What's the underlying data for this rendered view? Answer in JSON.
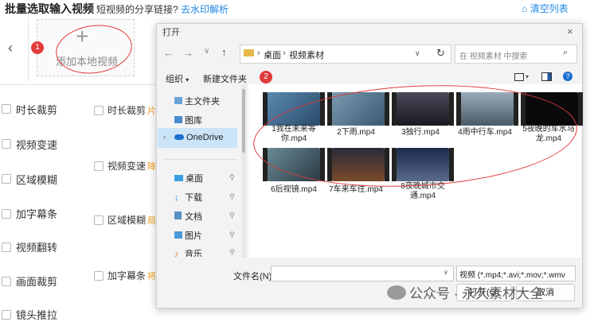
{
  "app": {
    "title": "批量选取输入视频",
    "share_prompt": "短视频的分享链接?",
    "remove_watermark_link": "去水印解析",
    "clear_list": "清空列表",
    "add_local_video": "添加本地视频",
    "left_options": [
      "时长裁剪",
      "视频变速",
      "区域模糊",
      "加字幕条",
      "视频翻转",
      "画面裁剪",
      "镜头推拉"
    ],
    "mid_options": [
      {
        "label": "时长裁剪",
        "hint": "片"
      },
      {
        "label": "视频变速",
        "hint": "降"
      },
      {
        "label": "区域模糊",
        "hint": "局"
      },
      {
        "label": "加字幕条",
        "hint": "将"
      }
    ]
  },
  "annotations": {
    "badge1": "1",
    "badge2": "2",
    "accent": "#e23b3b"
  },
  "dialog": {
    "title": "打开",
    "close": "×",
    "nav": {
      "back": "←",
      "forward": "→",
      "dropdown": "∨",
      "up": "↑"
    },
    "breadcrumb": [
      "桌面",
      "视频素材"
    ],
    "refresh": "↻",
    "search_placeholder": "在 视频素材 中搜索",
    "organize": "组织",
    "new_folder": "新建文件夹",
    "help": "?",
    "nav_pane": [
      {
        "label": "主文件夹",
        "icon": "home-icon"
      },
      {
        "label": "图库",
        "icon": "gallery-icon"
      },
      {
        "label": "OneDrive",
        "icon": "cloud-icon",
        "selected": true
      },
      {
        "label": "桌面",
        "icon": "desktop-icon",
        "pinned": true
      },
      {
        "label": "下载",
        "icon": "download-icon",
        "pinned": true
      },
      {
        "label": "文档",
        "icon": "document-icon",
        "pinned": true
      },
      {
        "label": "图片",
        "icon": "picture-icon",
        "pinned": true
      },
      {
        "label": "音乐",
        "icon": "music-icon",
        "pinned": true
      }
    ],
    "files": [
      {
        "name": "1我在未来等你.mp4",
        "color": "#3a6a8a"
      },
      {
        "name": "2下雨.mp4",
        "color": "#5a7a92"
      },
      {
        "name": "3独行.mp4",
        "color": "#3a3a44"
      },
      {
        "name": "4雨中行车.mp4",
        "color": "#6e7e8a"
      },
      {
        "name": "5夜晚的车水马龙.mp4",
        "color": "#0a0a0c"
      },
      {
        "name": "6后视镜.mp4",
        "color": "#3e5660"
      },
      {
        "name": "7车来车往.mp4",
        "color": "#4a3a2a"
      },
      {
        "name": "8夜晚城市交通.mp4",
        "color": "#2a3a5a"
      }
    ],
    "filename_label": "文件名(N):",
    "filename_value": "",
    "filetype": "视频 (*.mp4;*.avi;*.mov;*.wmv",
    "open_btn": "打开(O)",
    "cancel_btn": "取消"
  },
  "watermark": "公众号 · 永久素材大全"
}
